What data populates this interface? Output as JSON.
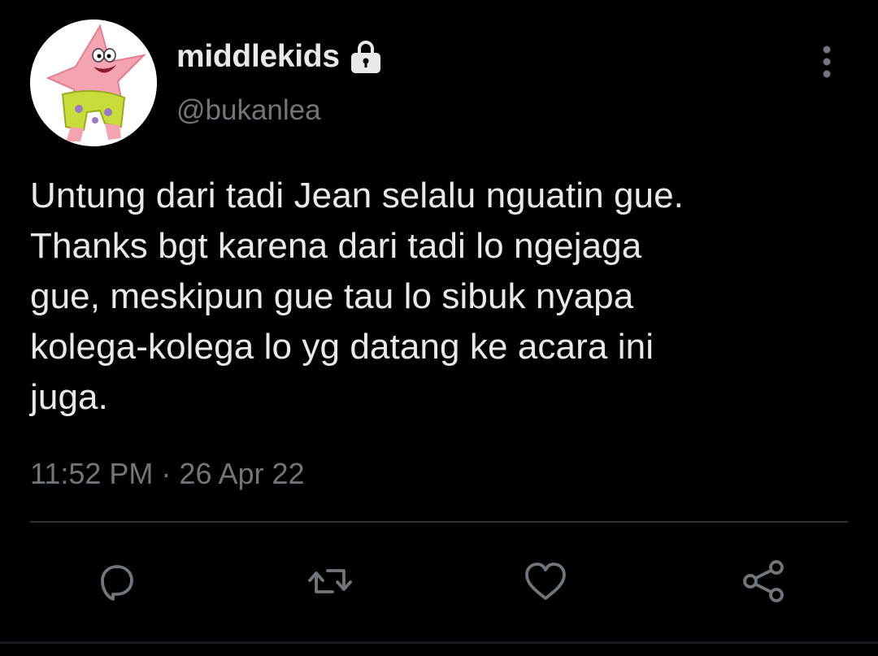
{
  "tweet": {
    "author": {
      "display_name": "middlekids",
      "handle": "@bukanlea",
      "protected_icon": "lock-icon",
      "avatar_icon": "patrick-star-avatar"
    },
    "text": "Untung dari tadi Jean selalu nguatin gue.\nThanks bgt karena dari tadi lo ngejaga\ngue, meskipun gue tau lo sibuk nyapa\nkolega-kolega lo yg datang ke acara ini\njuga.",
    "time": "11:52 PM",
    "separator": "·",
    "date": "26 Apr 22",
    "more_icon": "more-vertical-icon"
  },
  "actions": [
    {
      "name": "reply",
      "icon": "reply-icon"
    },
    {
      "name": "retweet",
      "icon": "retweet-icon"
    },
    {
      "name": "like",
      "icon": "heart-icon"
    },
    {
      "name": "share",
      "icon": "share-icon"
    }
  ],
  "colors": {
    "background": "#000000",
    "primary_text": "#e7e9ea",
    "secondary_text": "#71767b",
    "divider": "#2f3336",
    "action_icon": "#71767b"
  }
}
